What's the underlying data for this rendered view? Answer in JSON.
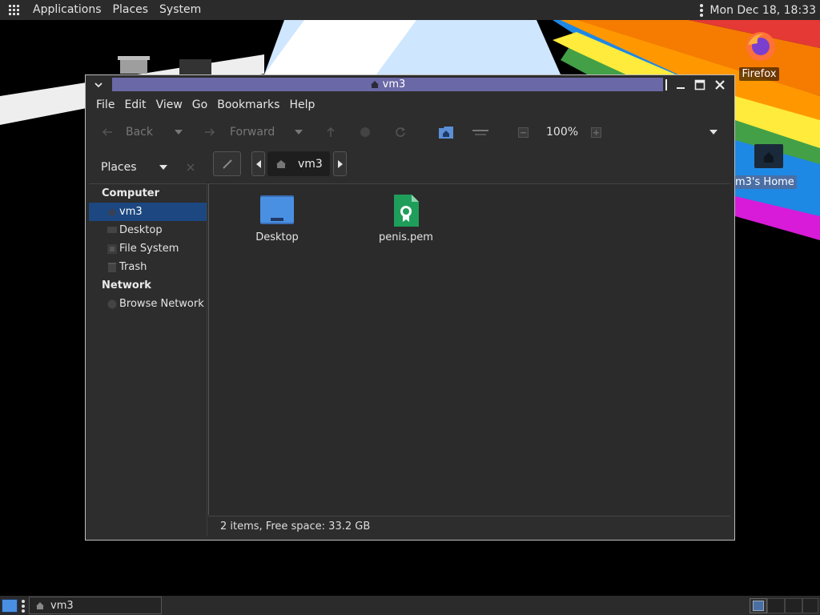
{
  "top_panel": {
    "menus": [
      "Applications",
      "Places",
      "System"
    ],
    "clock": "Mon Dec 18, 18:33"
  },
  "desktop": {
    "icons": [
      {
        "label": "Firefox"
      },
      {
        "label": "m3's Home"
      }
    ]
  },
  "window": {
    "title": "vm3",
    "menubar": [
      "File",
      "Edit",
      "View",
      "Go",
      "Bookmarks",
      "Help"
    ],
    "toolbar": {
      "back_label": "Back",
      "forward_label": "Forward",
      "zoom": "100%"
    },
    "sidebar_selector": "Places",
    "path": {
      "current": "vm3"
    },
    "sidebar": {
      "computer_header": "Computer",
      "computer_items": [
        "vm3",
        "Desktop",
        "File System",
        "Trash"
      ],
      "network_header": "Network",
      "network_items": [
        "Browse Network"
      ]
    },
    "files": [
      {
        "name": "Desktop",
        "icon": "folder-icon"
      },
      {
        "name": "penis.pem",
        "icon": "certificate-file-icon"
      }
    ],
    "status": "2 items, Free space: 33.2 GB"
  },
  "taskbar": {
    "task_label": "vm3"
  },
  "colors": {
    "title_active": "#6a68a6",
    "selection": "#1c4780",
    "folder_blue": "#4a90e2",
    "cert_green": "#1e9e5a"
  }
}
